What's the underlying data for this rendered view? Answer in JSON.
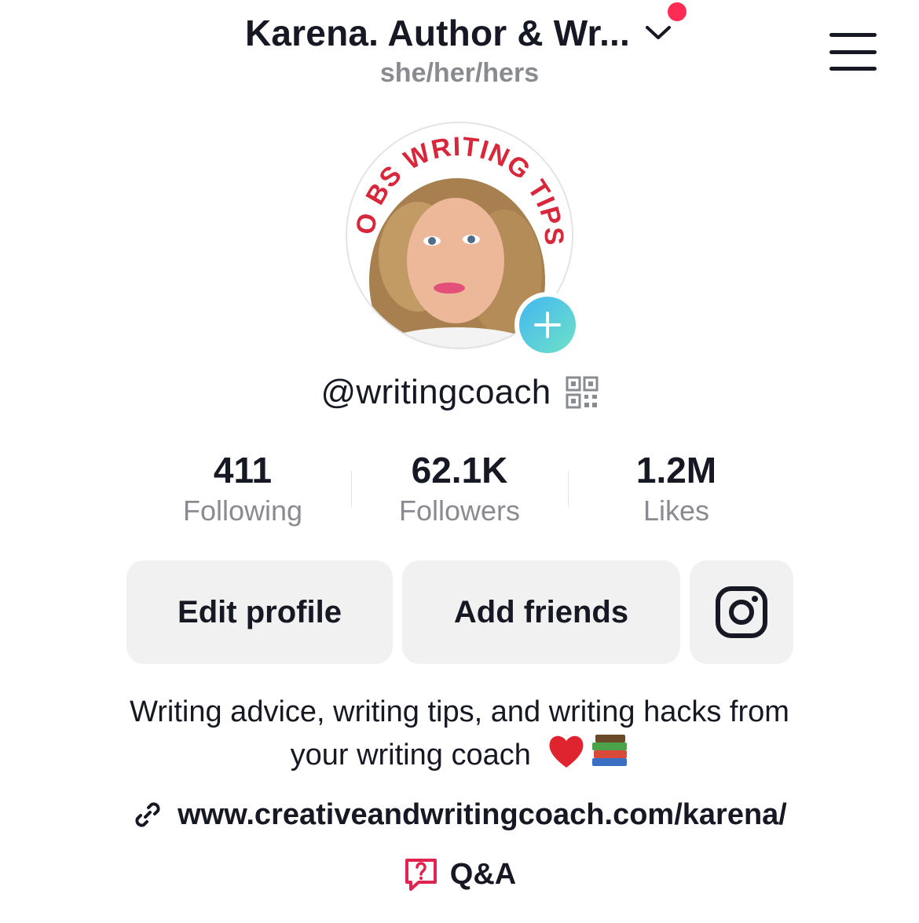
{
  "header": {
    "title": "Karena. Author & Wr...",
    "pronouns": "she/her/hers"
  },
  "profile": {
    "avatar_badge_text": "NO BS WRITING TIPS!",
    "username": "@writingcoach"
  },
  "stats": [
    {
      "value": "411",
      "label": "Following"
    },
    {
      "value": "62.1K",
      "label": "Followers"
    },
    {
      "value": "1.2M",
      "label": "Likes"
    }
  ],
  "actions": {
    "edit_profile": "Edit profile",
    "add_friends": "Add friends"
  },
  "bio": {
    "line1": "Writing advice, writing tips, and writing hacks from",
    "line2": "your writing coach",
    "emojis": "❤️📚",
    "link": "www.creativeandwritingcoach.com/karena/",
    "qa": "Q&A"
  },
  "colors": {
    "accent": "#fe2c55",
    "text": "#161823",
    "muted": "#8a8b91",
    "button_bg": "#f1f1f2"
  },
  "icons": [
    "chevron-down-icon",
    "hamburger-menu-icon",
    "plus-icon",
    "qr-code-icon",
    "instagram-icon",
    "link-icon",
    "qa-icon"
  ]
}
